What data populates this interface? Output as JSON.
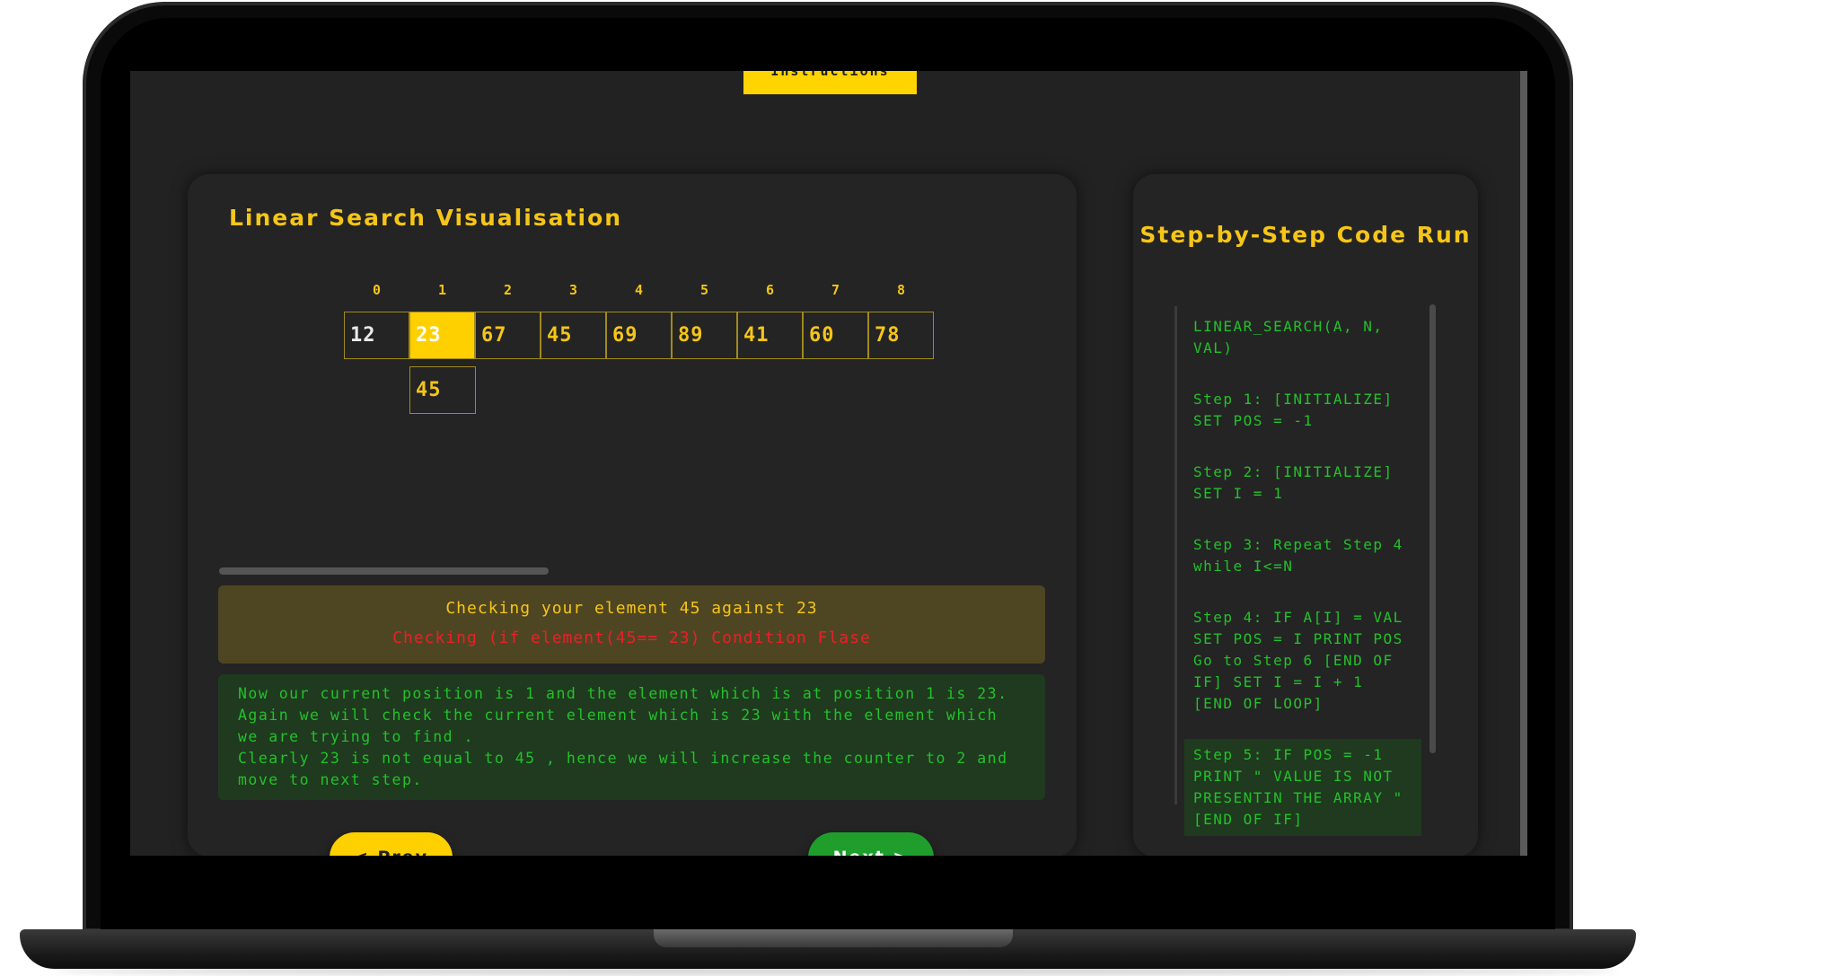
{
  "instructions_tab": "Instructions",
  "main": {
    "title": "Linear Search Visualisation",
    "indices": [
      "0",
      "1",
      "2",
      "3",
      "4",
      "5",
      "6",
      "7",
      "8"
    ],
    "array": [
      "12",
      "23",
      "67",
      "45",
      "69",
      "89",
      "41",
      "60",
      "78"
    ],
    "active_index": 1,
    "target_value": "45",
    "progress": 0.4,
    "status_line1": "Checking your element 45 against 23",
    "status_line2": "Checking (if element(45== 23) Condition Flase",
    "explanation": [
      "Now our current position is 1 and the element which is at position 1 is 23.",
      "Again we will check the current element which is 23 with the element which we are trying to find .",
      "Clearly 23 is not equal to 45 , hence we will increase the counter to 2 and move to next step."
    ],
    "prev_label": "< Prev",
    "next_label": "Next >"
  },
  "code_panel": {
    "title": "Step-by-Step Code Run",
    "steps": [
      "LINEAR_SEARCH(A, N, VAL)",
      "Step 1: [INITIALIZE] SET POS = -1",
      "Step 2: [INITIALIZE] SET I = 1",
      "Step 3: Repeat Step 4 while I<=N",
      "Step 4: IF A[I] = VAL SET POS = I PRINT POS Go to Step 6 [END OF IF] SET I = I + 1 [END OF LOOP]",
      "Step 5: IF POS = -1 PRINT \" VALUE IS NOT PRESENTIN THE ARRAY \" [END OF IF]"
    ],
    "active_step": 5
  },
  "colors": {
    "accent": "#f5c518",
    "success": "#22c12a",
    "error": "#e8202a",
    "background": "#222222"
  }
}
